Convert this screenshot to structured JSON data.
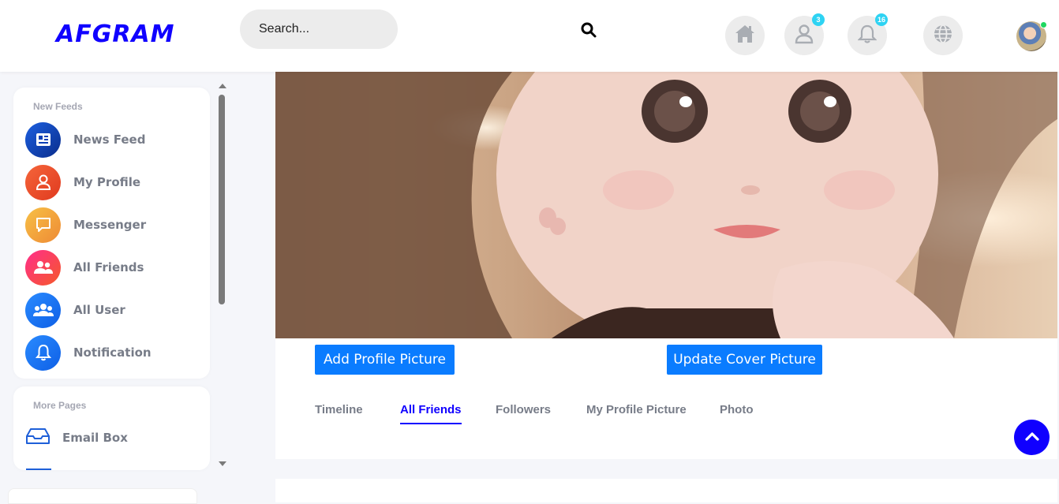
{
  "header": {
    "logo": "AFGRAM",
    "search_placeholder": "Search...",
    "icons": [
      {
        "name": "home-icon"
      },
      {
        "name": "user-icon",
        "badge": "3"
      },
      {
        "name": "bell-icon",
        "badge": "16"
      },
      {
        "name": "globe-icon"
      }
    ]
  },
  "sidebar": {
    "section1_title": "New Feeds",
    "items": [
      {
        "label": "News Feed",
        "icon": "newspaper-icon",
        "color": "#0a3fb6"
      },
      {
        "label": "My Profile",
        "icon": "user-icon",
        "color": "#ea4a25"
      },
      {
        "label": "Messenger",
        "icon": "chat-icon",
        "color": "#f2a93b"
      },
      {
        "label": "All Friends",
        "icon": "users-icon",
        "color": "#f0245f"
      },
      {
        "label": "All User",
        "icon": "users-group-icon",
        "color": "#1e74f5"
      },
      {
        "label": "Notification",
        "icon": "bell-icon",
        "color": "#1e74f5"
      }
    ],
    "section2_title": "More Pages",
    "more_items": [
      {
        "label": "Email Box",
        "icon": "inbox-icon"
      }
    ]
  },
  "profile": {
    "add_profile_picture": "Add Profile Picture",
    "update_cover_picture": "Update Cover Picture",
    "tabs": [
      {
        "label": "Timeline",
        "active": false
      },
      {
        "label": "All Friends",
        "active": true
      },
      {
        "label": "Followers",
        "active": false
      },
      {
        "label": "My Profile Picture",
        "active": false
      },
      {
        "label": "Photo",
        "active": false
      }
    ]
  },
  "colors": {
    "brand": "#1000ff",
    "button": "#0a7cff",
    "badge": "#2ed3f3"
  }
}
